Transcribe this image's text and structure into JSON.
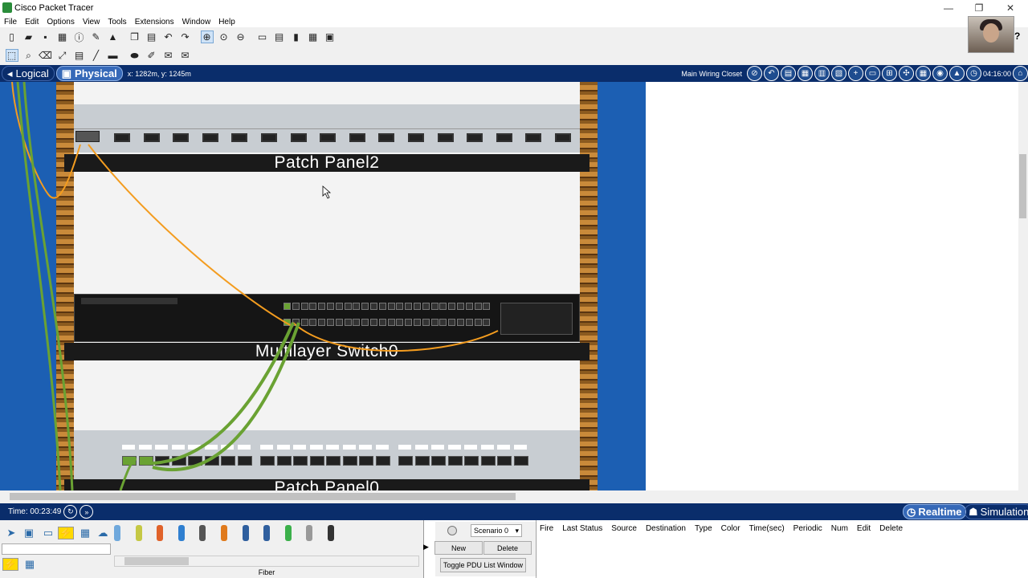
{
  "window": {
    "title": "Cisco Packet Tracer",
    "minimize": "—",
    "restore": "❐",
    "close": "✕"
  },
  "menu": [
    "File",
    "Edit",
    "Options",
    "View",
    "Tools",
    "Extensions",
    "Window",
    "Help"
  ],
  "toolbar1_icons": [
    "new-file-icon",
    "open-icon",
    "save-icon",
    "print-icon",
    "info-icon",
    "wrench-icon",
    "activity-wizard-icon",
    "copy-icon",
    "paste-icon",
    "undo-icon",
    "redo-icon",
    "zoom-in-icon",
    "zoom-reset-icon",
    "zoom-out-icon",
    "rectangle-icon",
    "palette-icon",
    "notes-icon",
    "device-template-icon",
    "image-icon"
  ],
  "toolbar2_icons": [
    "select-icon",
    "inspect-icon",
    "delete-icon",
    "resize-icon",
    "note-icon",
    "line-icon",
    "rect-shape-icon",
    "ellipse-icon",
    "freeform-icon",
    "simple-pdu-icon",
    "complex-pdu-icon"
  ],
  "help_label": "?",
  "modebar": {
    "logical_label": "Logical",
    "physical_label": "Physical",
    "coords": "x: 1282m, y: 1245m",
    "location_label": "Main Wiring Closet",
    "clock": "04:16:00"
  },
  "rack": {
    "devices": [
      {
        "name": "Patch Panel2"
      },
      {
        "name": "Multilayer Switch0"
      },
      {
        "name": "Patch Panel0"
      }
    ]
  },
  "timebar": {
    "time": "Time: 00:23:49",
    "realtime_label": "Realtime",
    "simulation_label": "Simulation"
  },
  "device_panel": {
    "cable_label": "Fiber"
  },
  "pdu": {
    "scenario": "Scenario 0",
    "new_label": "New",
    "delete_label": "Delete",
    "toggle_label": "Toggle PDU List Window",
    "columns": [
      "Fire",
      "Last Status",
      "Source",
      "Destination",
      "Type",
      "Color",
      "Time(sec)",
      "Periodic",
      "Num",
      "Edit",
      "Delete"
    ]
  },
  "colors": {
    "modebar": "#0a2d6b",
    "rack_blue": "#1c5fb3",
    "fiber_cable": "#f39c1f",
    "copper_cable": "#6aa233"
  }
}
